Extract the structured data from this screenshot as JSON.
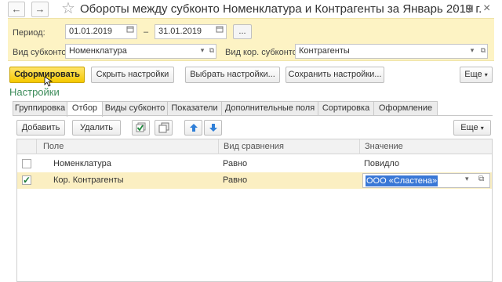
{
  "window": {
    "title": "Обороты между субконто Номенклатура и Контрагенты за Январь 2019 г.",
    "back_icon": "←",
    "forward_icon": "→",
    "star_icon": "☆",
    "more_icon": "⋮",
    "pin_icon": "⊞",
    "close_icon": "×"
  },
  "params": {
    "period_label": "Период:",
    "date_from": "01.01.2019",
    "date_dash": "–",
    "date_to": "31.01.2019",
    "ellipsis_label": "...",
    "subkonto_label": "Вид субконто:",
    "subkonto_value": "Номенклатура",
    "kor_subkonto_label": "Вид кор. субконто:",
    "kor_subkonto_value": "Контрагенты"
  },
  "actions": {
    "generate_label": "Сформировать",
    "hide_settings_label": "Скрыть настройки",
    "choose_settings_label": "Выбрать настройки...",
    "save_settings_label": "Сохранить настройки...",
    "more_label": "Еще"
  },
  "settings": {
    "section_title": "Настройки",
    "tabs": [
      {
        "label": "Группировка"
      },
      {
        "label": "Отбор"
      },
      {
        "label": "Виды субконто"
      },
      {
        "label": "Показатели"
      },
      {
        "label": "Дополнительные поля"
      },
      {
        "label": "Сортировка"
      },
      {
        "label": "Оформление"
      }
    ],
    "active_tab": "Отбор"
  },
  "toolbar": {
    "add_label": "Добавить",
    "delete_label": "Удалить",
    "more_label": "Еще"
  },
  "filter_table": {
    "columns": [
      "Поле",
      "Вид сравнения",
      "Значение"
    ],
    "rows": [
      {
        "checked": false,
        "field": "Номенклатура",
        "comparison": "Равно",
        "value": "Повидло"
      },
      {
        "checked": true,
        "field": "Кор. Контрагенты",
        "comparison": "Равно",
        "value": "ООО «Сластена»"
      }
    ]
  },
  "colors": {
    "accent_green": "#3c8c5a",
    "primary_button": "#f5c800",
    "params_background": "#fdf3c4",
    "selected_row": "#fbefc2",
    "selection_highlight": "#3a78d6"
  }
}
